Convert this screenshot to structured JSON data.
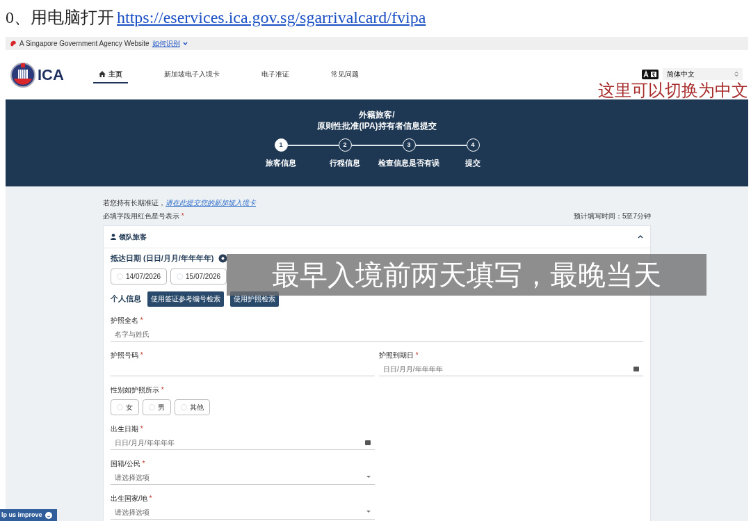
{
  "doc_heading": {
    "prefix": "0、用电脑打开",
    "link": "https://eservices.ica.gov.sg/sgarrivalcard/fvipa"
  },
  "gov_bar": {
    "text": "A Singapore Government Agency Website",
    "link": "如何识别"
  },
  "header": {
    "logo_text": "ICA",
    "nav": [
      {
        "label": "主页",
        "selected": true
      },
      {
        "label": "新加坡电子入境卡",
        "selected": false
      },
      {
        "label": "电子准证",
        "selected": false
      },
      {
        "label": "常见问题",
        "selected": false
      }
    ],
    "language": {
      "value": "简体中文"
    }
  },
  "annotation": "这里可以切换为中文",
  "banner": {
    "title_lines": [
      "外籍旅客/",
      "原则性批准(IPA)持有者信息提交"
    ],
    "steps": [
      {
        "number": "1",
        "label": "旅客信息",
        "selected": true
      },
      {
        "number": "2",
        "label": "行程信息",
        "selected": false
      },
      {
        "number": "3",
        "label": "检查信息是否有误",
        "selected": false
      },
      {
        "number": "4",
        "label": "提交",
        "selected": false
      }
    ]
  },
  "form": {
    "notice": {
      "text": "若您持有长期准证，",
      "link": "请在此提交您的新加坡入境卡"
    },
    "required_note": {
      "text": "必填字段用红色星号表示",
      "mark": "*"
    },
    "estimate": "预计填写时间：5至7分钟",
    "section": {
      "title": "领队旅客",
      "expanded": true
    },
    "arrival": {
      "label": "抵达日期 (日日/月月/年年年年)",
      "dates": [
        {
          "label": "14/07/2026",
          "selected": false
        },
        {
          "label": "15/07/2026",
          "selected": false
        }
      ]
    },
    "personal": {
      "label": "个人信息",
      "buttons": [
        "使用签证参考编号检索",
        "使用护照检索"
      ]
    },
    "rows": [
      {
        "fields": [
          {
            "kind": "text",
            "label": "护照全名",
            "mark": "*",
            "placeholder": "名字与姓氏"
          }
        ]
      },
      {
        "fields": [
          {
            "kind": "text",
            "label": "护照号码",
            "mark": "*"
          },
          {
            "kind": "date",
            "label": "护照到期日",
            "mark": "*",
            "placeholder": "日日/月月/年年年年"
          }
        ]
      },
      {
        "fields": [
          {
            "kind": "radio",
            "label": "性别如护照所示",
            "mark": "*",
            "options": [
              {
                "label": "女",
                "selected": false
              },
              {
                "label": "男",
                "selected": false
              },
              {
                "label": "其他",
                "selected": false
              }
            ]
          }
        ]
      },
      {
        "fields": [
          {
            "kind": "date",
            "label": "出生日期",
            "mark": "*",
            "placeholder": "日日/月月/年年年年"
          }
        ]
      },
      {
        "fields": [
          {
            "kind": "select",
            "label": "国籍/公民",
            "mark": "*",
            "placeholder": "请选择选项"
          }
        ]
      },
      {
        "fields": [
          {
            "kind": "select",
            "label": "出生国家/地",
            "mark": "*",
            "placeholder": "请选择选项"
          }
        ]
      }
    ]
  },
  "overlay_caption": "最早入境前两天填写，最晚当天",
  "feedback_tab": "lp us improve"
}
